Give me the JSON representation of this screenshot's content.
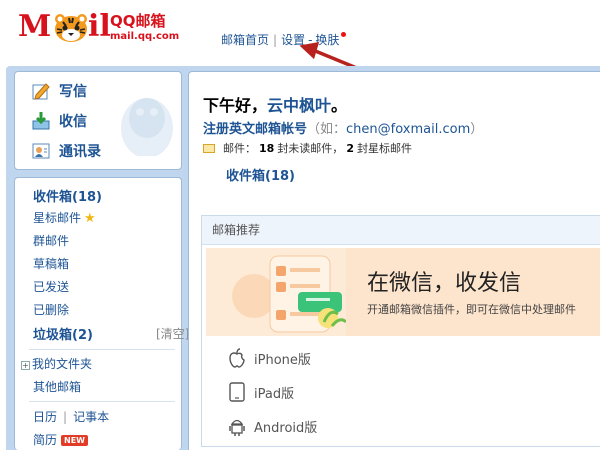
{
  "logo": {
    "m": "M",
    "il": "il",
    "qq_text": "QQ邮箱",
    "url": "mail.qq.com"
  },
  "topnav": {
    "home": "邮箱首页",
    "separator": "|",
    "settings": "设置",
    "dash": "-",
    "skin": "换肤"
  },
  "actions": [
    {
      "label": "写信",
      "icon": "write-icon"
    },
    {
      "label": "收信",
      "icon": "receive-icon"
    },
    {
      "label": "通讯录",
      "icon": "contacts-icon"
    }
  ],
  "folders": {
    "inbox": "收件箱",
    "inbox_count": "(18)",
    "starred": "星标邮件",
    "group": "群邮件",
    "drafts": "草稿箱",
    "sent": "已发送",
    "deleted": "已删除",
    "spam": "垃圾箱",
    "spam_count": "(2)",
    "clear": "[清空]",
    "my_folders": "我的文件夹",
    "other_mail": "其他邮箱",
    "calendar": "日历",
    "pipe": "|",
    "notes": "记事本",
    "resume": "简历",
    "new_badge": "NEW"
  },
  "main": {
    "greeting_prefix": "下午好，",
    "greeting_name": "云中枫叶",
    "greeting_suffix": "。",
    "register_link": "注册英文邮箱帐号",
    "register_open": "（如：",
    "register_example": "chen@foxmail.com",
    "register_close": "）",
    "mail_label": "邮件：",
    "unread_count": "18",
    "unread_text": "封未读邮件，",
    "star_count": "2",
    "star_text": "封星标邮件",
    "inbox_link": "收件箱(18)"
  },
  "recommend": {
    "title": "邮箱推荐",
    "banner_title": "在微信，收发信",
    "banner_sub": "开通邮箱微信插件，即可在微信中处理邮件",
    "platforms": [
      {
        "label": "iPhone版",
        "icon": "apple-icon"
      },
      {
        "label": "iPad版",
        "icon": "ipad-icon"
      },
      {
        "label": "Android版",
        "icon": "android-icon"
      }
    ]
  },
  "colors": {
    "brand_red": "#d8121c",
    "link_blue": "#1e5494",
    "frame_blue": "#bfd6ee",
    "arrow_red": "#b8221e"
  }
}
